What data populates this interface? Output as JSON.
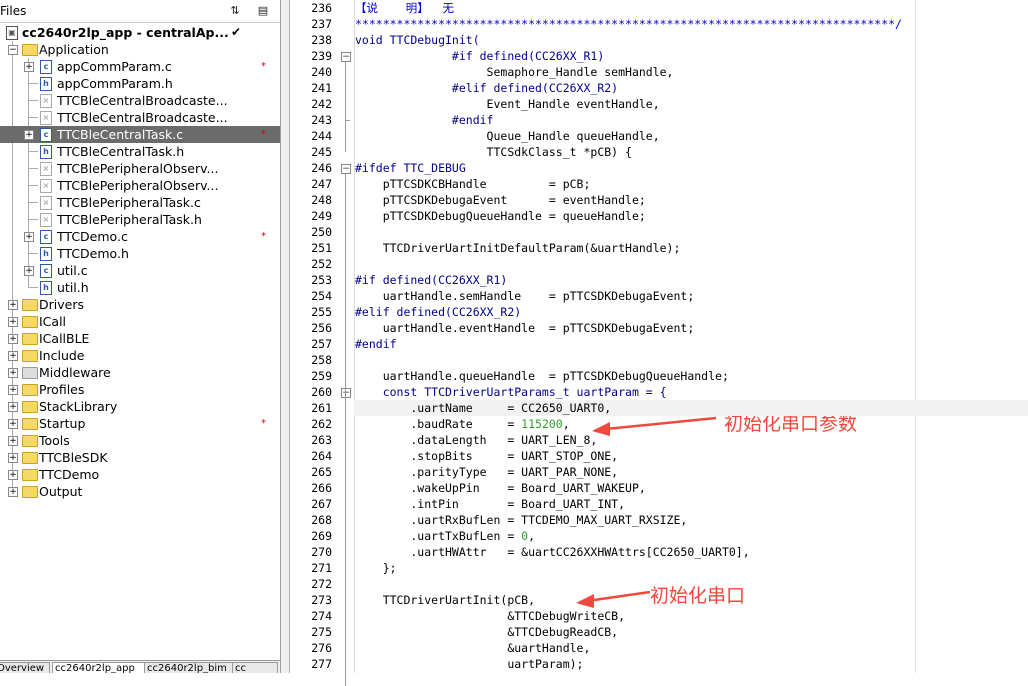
{
  "sidebar": {
    "title": "Files",
    "project": {
      "name": "cc2640r2lp_app - centralAp...",
      "check": "✔"
    },
    "items": [
      {
        "label": "Application",
        "type": "folder"
      },
      {
        "label": "appCommParam.c",
        "type": "c",
        "star": "*"
      },
      {
        "label": "appCommParam.h",
        "type": "h"
      },
      {
        "label": "TTCBleCentralBroadcaste...",
        "type": "disabled"
      },
      {
        "label": "TTCBleCentralBroadcaste...",
        "type": "disabled"
      },
      {
        "label": "TTCBleCentralTask.c",
        "type": "c",
        "star": "*"
      },
      {
        "label": "TTCBleCentralTask.h",
        "type": "h"
      },
      {
        "label": "TTCBlePeripheralObserv...",
        "type": "disabled"
      },
      {
        "label": "TTCBlePeripheralObserv...",
        "type": "disabled"
      },
      {
        "label": "TTCBlePeripheralTask.c",
        "type": "disabled"
      },
      {
        "label": "TTCBlePeripheralTask.h",
        "type": "disabled"
      },
      {
        "label": "TTCDemo.c",
        "type": "c",
        "star": "*"
      },
      {
        "label": "TTCDemo.h",
        "type": "h"
      },
      {
        "label": "util.c",
        "type": "c"
      },
      {
        "label": "util.h",
        "type": "h"
      },
      {
        "label": "Drivers",
        "type": "folder"
      },
      {
        "label": "ICall",
        "type": "folder"
      },
      {
        "label": "ICallBLE",
        "type": "folder"
      },
      {
        "label": "Include",
        "type": "folder"
      },
      {
        "label": "Middleware",
        "type": "folder-disabled"
      },
      {
        "label": "Profiles",
        "type": "folder"
      },
      {
        "label": "StackLibrary",
        "type": "folder"
      },
      {
        "label": "Startup",
        "type": "folder",
        "star": "*"
      },
      {
        "label": "Tools",
        "type": "folder"
      },
      {
        "label": "TTCBleSDK",
        "type": "folder"
      },
      {
        "label": "TTCDemo",
        "type": "folder"
      },
      {
        "label": "Output",
        "type": "folder"
      }
    ],
    "tabs": [
      "Overview",
      "cc2640r2lp_app",
      "cc2640r2lp_bim",
      "cc"
    ]
  },
  "editor": {
    "lines": [
      {
        "n": "236",
        "t": "【说    明】  无"
      },
      {
        "n": "237",
        "t": "******************************************************************************/"
      },
      {
        "n": "238",
        "t": "void TTCDebugInit("
      },
      {
        "n": "239",
        "t": "              #if defined(CC26XX_R1)"
      },
      {
        "n": "240",
        "t": "                   Semaphore_Handle semHandle,"
      },
      {
        "n": "241",
        "t": "              #elif defined(CC26XX_R2)"
      },
      {
        "n": "242",
        "t": "                   Event_Handle eventHandle,"
      },
      {
        "n": "243",
        "t": "              #endif"
      },
      {
        "n": "244",
        "t": "                   Queue_Handle queueHandle,"
      },
      {
        "n": "245",
        "t": "                   TTCSdkClass_t *pCB) {"
      },
      {
        "n": "246",
        "t": "#ifdef TTC_DEBUG"
      },
      {
        "n": "247",
        "t": "    pTTCSDKCBHandle         = pCB;"
      },
      {
        "n": "248",
        "t": "    pTTCSDKDebugaEvent      = eventHandle;"
      },
      {
        "n": "249",
        "t": "    pTTCSDKDebugQueueHandle = queueHandle;"
      },
      {
        "n": "250",
        "t": ""
      },
      {
        "n": "251",
        "t": "    TTCDriverUartInitDefaultParam(&uartHandle);"
      },
      {
        "n": "252",
        "t": ""
      },
      {
        "n": "253",
        "t": "#if defined(CC26XX_R1)"
      },
      {
        "n": "254",
        "t": "    uartHandle.semHandle    = pTTCSDKDebugaEvent;"
      },
      {
        "n": "255",
        "t": "#elif defined(CC26XX_R2)"
      },
      {
        "n": "256",
        "t": "    uartHandle.eventHandle  = pTTCSDKDebugaEvent;"
      },
      {
        "n": "257",
        "t": "#endif"
      },
      {
        "n": "258",
        "t": ""
      },
      {
        "n": "259",
        "t": "    uartHandle.queueHandle  = pTTCSDKDebugQueueHandle;"
      },
      {
        "n": "260",
        "t": "    const TTCDriverUartParams_t uartParam = {"
      },
      {
        "n": "261",
        "t": "        .uartName     = CC2650_UART0,"
      },
      {
        "n": "262",
        "t": "        .baudRate     = 115200,"
      },
      {
        "n": "263",
        "t": "        .dataLength   = UART_LEN_8,"
      },
      {
        "n": "264",
        "t": "        .stopBits     = UART_STOP_ONE,"
      },
      {
        "n": "265",
        "t": "        .parityType   = UART_PAR_NONE,"
      },
      {
        "n": "266",
        "t": "        .wakeUpPin    = Board_UART_WAKEUP,"
      },
      {
        "n": "267",
        "t": "        .intPin       = Board_UART_INT,"
      },
      {
        "n": "268",
        "t": "        .uartRxBufLen = TTCDEMO_MAX_UART_RXSIZE,"
      },
      {
        "n": "269",
        "t": "        .uartTxBufLen = 0,"
      },
      {
        "n": "270",
        "t": "        .uartHWAttr   = &uartCC26XXHWAttrs[CC2650_UART0],"
      },
      {
        "n": "271",
        "t": "    };"
      },
      {
        "n": "272",
        "t": ""
      },
      {
        "n": "273",
        "t": "    TTCDriverUartInit(pCB,"
      },
      {
        "n": "274",
        "t": "                      &TTCDebugWriteCB,"
      },
      {
        "n": "275",
        "t": "                      &TTCDebugReadCB,"
      },
      {
        "n": "276",
        "t": "                      &uartHandle,"
      },
      {
        "n": "277",
        "t": "                      uartParam);"
      }
    ],
    "annotations": {
      "init_uart_params": "初始化串口参数",
      "init_uart": "初始化串口"
    }
  },
  "colors": {
    "annotation": "#f0483c",
    "selection": "#6b6b6b",
    "keyword": "#00008b"
  }
}
